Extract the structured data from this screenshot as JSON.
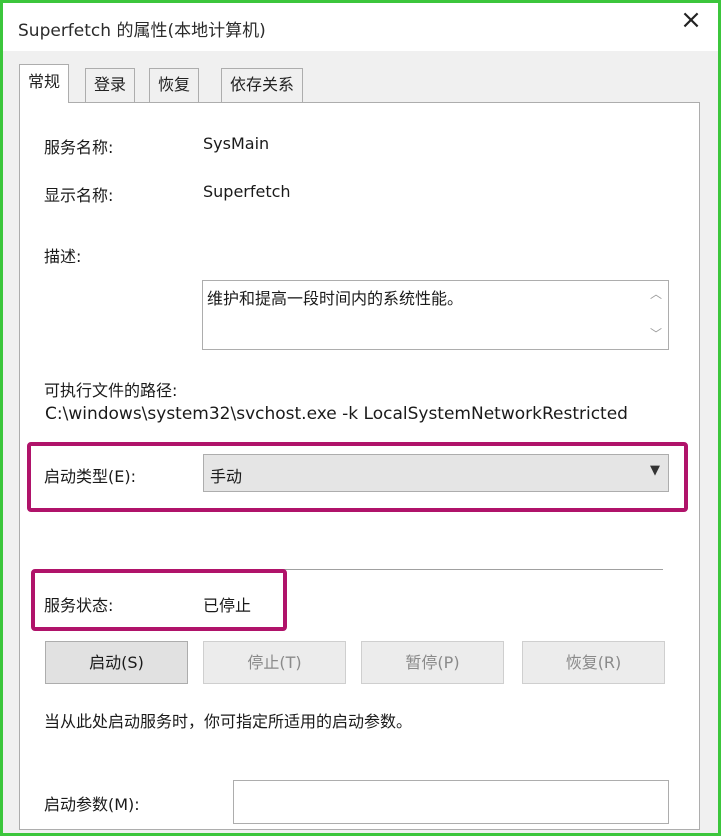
{
  "window": {
    "title": "Superfetch 的属性(本地计算机)",
    "close_glyph": "×"
  },
  "tabs": [
    {
      "label": "常规",
      "active": true
    },
    {
      "label": "登录",
      "active": false
    },
    {
      "label": "恢复",
      "active": false
    },
    {
      "label": "依存关系",
      "active": false
    }
  ],
  "general": {
    "service_name_label": "服务名称:",
    "service_name_value": "SysMain",
    "display_name_label": "显示名称:",
    "display_name_value": "Superfetch",
    "description_label": "描述:",
    "description_value": "维护和提高一段时间内的系统性能。",
    "exe_path_label": "可执行文件的路径:",
    "exe_path_value": "C:\\windows\\system32\\svchost.exe -k LocalSystemNetworkRestricted",
    "startup_type_label": "启动类型(E):",
    "startup_type_value": "手动",
    "service_status_label": "服务状态:",
    "service_status_value": "已停止",
    "buttons": {
      "start": "启动(S)",
      "stop": "停止(T)",
      "pause": "暂停(P)",
      "resume": "恢复(R)"
    },
    "start_params_hint": "当从此处启动服务时，你可指定所适用的启动参数。",
    "start_params_label": "启动参数(M):",
    "start_params_value": ""
  },
  "colors": {
    "window_border": "#3cc63c",
    "highlight": "#b0136a"
  }
}
